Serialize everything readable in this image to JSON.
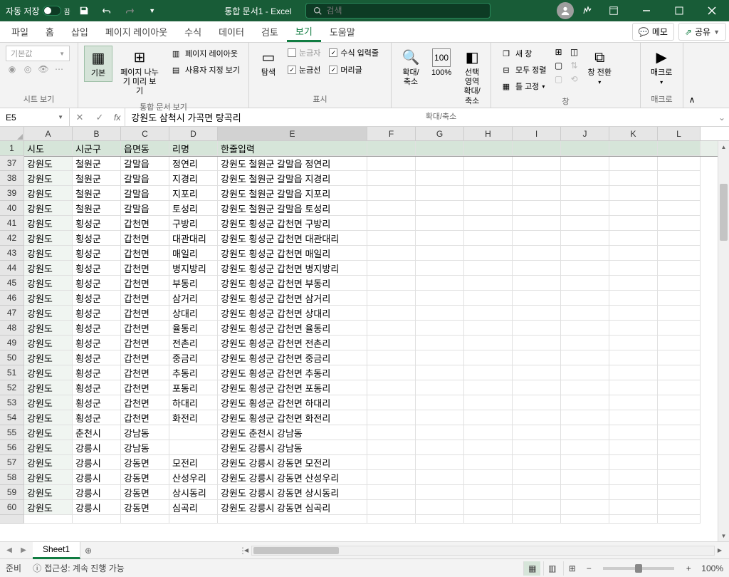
{
  "titlebar": {
    "autosave_label": "자동 저장",
    "autosave_state": "끔",
    "doc_title": "통합 문서1 - Excel",
    "search_placeholder": "검색"
  },
  "menu": {
    "tabs": [
      "파일",
      "홈",
      "삽입",
      "페이지 레이아웃",
      "수식",
      "데이터",
      "검토",
      "보기",
      "도움말"
    ],
    "active_index": 7,
    "memo": "메모",
    "share": "공유"
  },
  "ribbon": {
    "group_sheetview": "시트 보기",
    "sheetview_default": "기본값",
    "group_workbookview": "통합 문서 보기",
    "view_normal": "기본",
    "view_pagebreak": "페이지 나누기 미리 보기",
    "view_pagelayout": "페이지 레이아웃",
    "view_custom": "사용자 지정 보기",
    "group_show": "표시",
    "show_navigate": "탐색",
    "show_ruler": "눈금자",
    "show_formula": "수식 입력줄",
    "show_grid": "눈금선",
    "show_headings": "머리글",
    "group_zoom": "확대/축소",
    "zoom_zoom": "확대/축소",
    "zoom_100": "100%",
    "zoom_selection": "선택 영역 확대/축소",
    "group_window": "창",
    "win_new": "새 창",
    "win_arrange": "모두 정렬",
    "win_freeze": "틀 고정",
    "win_switch": "창 전환",
    "group_macro": "매크로",
    "macro": "매크로"
  },
  "formula": {
    "cell_ref": "E5",
    "value": "강원도 삼척시 가곡면 탕곡리"
  },
  "columns": [
    "A",
    "B",
    "C",
    "D",
    "E",
    "F",
    "G",
    "H",
    "I",
    "J",
    "K",
    "L"
  ],
  "header_row": {
    "num": "1",
    "cells": [
      "시도",
      "시군구",
      "읍면동",
      "리명",
      "한줄입력",
      "",
      "",
      "",
      "",
      "",
      "",
      ""
    ]
  },
  "rows": [
    {
      "num": "37",
      "cells": [
        "강원도",
        "철원군",
        "갈말읍",
        "정연리",
        "강원도 철원군 갈말읍 정연리",
        "",
        "",
        "",
        "",
        "",
        "",
        ""
      ]
    },
    {
      "num": "38",
      "cells": [
        "강원도",
        "철원군",
        "갈말읍",
        "지경리",
        "강원도 철원군 갈말읍 지경리",
        "",
        "",
        "",
        "",
        "",
        "",
        ""
      ]
    },
    {
      "num": "39",
      "cells": [
        "강원도",
        "철원군",
        "갈말읍",
        "지포리",
        "강원도 철원군 갈말읍 지포리",
        "",
        "",
        "",
        "",
        "",
        "",
        ""
      ]
    },
    {
      "num": "40",
      "cells": [
        "강원도",
        "철원군",
        "갈말읍",
        "토성리",
        "강원도 철원군 갈말읍 토성리",
        "",
        "",
        "",
        "",
        "",
        "",
        ""
      ]
    },
    {
      "num": "41",
      "cells": [
        "강원도",
        "횡성군",
        "갑천면",
        "구방리",
        "강원도 횡성군 갑천면 구방리",
        "",
        "",
        "",
        "",
        "",
        "",
        ""
      ]
    },
    {
      "num": "42",
      "cells": [
        "강원도",
        "횡성군",
        "갑천면",
        "대관대리",
        "강원도 횡성군 갑천면 대관대리",
        "",
        "",
        "",
        "",
        "",
        "",
        ""
      ]
    },
    {
      "num": "43",
      "cells": [
        "강원도",
        "횡성군",
        "갑천면",
        "매일리",
        "강원도 횡성군 갑천면 매일리",
        "",
        "",
        "",
        "",
        "",
        "",
        ""
      ]
    },
    {
      "num": "44",
      "cells": [
        "강원도",
        "횡성군",
        "갑천면",
        "병지방리",
        "강원도 횡성군 갑천면 병지방리",
        "",
        "",
        "",
        "",
        "",
        "",
        ""
      ]
    },
    {
      "num": "45",
      "cells": [
        "강원도",
        "횡성군",
        "갑천면",
        "부동리",
        "강원도 횡성군 갑천면 부동리",
        "",
        "",
        "",
        "",
        "",
        "",
        ""
      ]
    },
    {
      "num": "46",
      "cells": [
        "강원도",
        "횡성군",
        "갑천면",
        "삼거리",
        "강원도 횡성군 갑천면 삼거리",
        "",
        "",
        "",
        "",
        "",
        "",
        ""
      ]
    },
    {
      "num": "47",
      "cells": [
        "강원도",
        "횡성군",
        "갑천면",
        "상대리",
        "강원도 횡성군 갑천면 상대리",
        "",
        "",
        "",
        "",
        "",
        "",
        ""
      ]
    },
    {
      "num": "48",
      "cells": [
        "강원도",
        "횡성군",
        "갑천면",
        "율동리",
        "강원도 횡성군 갑천면 율동리",
        "",
        "",
        "",
        "",
        "",
        "",
        ""
      ]
    },
    {
      "num": "49",
      "cells": [
        "강원도",
        "횡성군",
        "갑천면",
        "전촌리",
        "강원도 횡성군 갑천면 전촌리",
        "",
        "",
        "",
        "",
        "",
        "",
        ""
      ]
    },
    {
      "num": "50",
      "cells": [
        "강원도",
        "횡성군",
        "갑천면",
        "중금리",
        "강원도 횡성군 갑천면 중금리",
        "",
        "",
        "",
        "",
        "",
        "",
        ""
      ]
    },
    {
      "num": "51",
      "cells": [
        "강원도",
        "횡성군",
        "갑천면",
        "추동리",
        "강원도 횡성군 갑천면 추동리",
        "",
        "",
        "",
        "",
        "",
        "",
        ""
      ]
    },
    {
      "num": "52",
      "cells": [
        "강원도",
        "횡성군",
        "갑천면",
        "포동리",
        "강원도 횡성군 갑천면 포동리",
        "",
        "",
        "",
        "",
        "",
        "",
        ""
      ]
    },
    {
      "num": "53",
      "cells": [
        "강원도",
        "횡성군",
        "갑천면",
        "하대리",
        "강원도 횡성군 갑천면 하대리",
        "",
        "",
        "",
        "",
        "",
        "",
        ""
      ]
    },
    {
      "num": "54",
      "cells": [
        "강원도",
        "횡성군",
        "갑천면",
        "화전리",
        "강원도 횡성군 갑천면 화전리",
        "",
        "",
        "",
        "",
        "",
        "",
        ""
      ]
    },
    {
      "num": "55",
      "cells": [
        "강원도",
        "춘천시",
        "강남동",
        "",
        "강원도 춘천시 강남동",
        "",
        "",
        "",
        "",
        "",
        "",
        ""
      ]
    },
    {
      "num": "56",
      "cells": [
        "강원도",
        "강릉시",
        "강남동",
        "",
        "강원도 강릉시 강남동",
        "",
        "",
        "",
        "",
        "",
        "",
        ""
      ]
    },
    {
      "num": "57",
      "cells": [
        "강원도",
        "강릉시",
        "강동면",
        "모전리",
        "강원도 강릉시 강동면 모전리",
        "",
        "",
        "",
        "",
        "",
        "",
        ""
      ]
    },
    {
      "num": "58",
      "cells": [
        "강원도",
        "강릉시",
        "강동면",
        "산성우리",
        "강원도 강릉시 강동면 산성우리",
        "",
        "",
        "",
        "",
        "",
        "",
        ""
      ]
    },
    {
      "num": "59",
      "cells": [
        "강원도",
        "강릉시",
        "강동면",
        "상시동리",
        "강원도 강릉시 강동면 상시동리",
        "",
        "",
        "",
        "",
        "",
        "",
        ""
      ]
    },
    {
      "num": "60",
      "cells": [
        "강원도",
        "강릉시",
        "강동면",
        "심곡리",
        "강원도 강릉시 강동면 심곡리",
        "",
        "",
        "",
        "",
        "",
        "",
        ""
      ]
    }
  ],
  "sheet": {
    "name": "Sheet1"
  },
  "status": {
    "ready": "준비",
    "accessibility": "접근성: 계속 진행 가능",
    "zoom": "100%"
  },
  "col_widths": [
    "cw-A",
    "cw-B",
    "cw-C",
    "cw-D",
    "cw-E",
    "cw-F",
    "cw-G",
    "cw-H",
    "cw-I",
    "cw-J",
    "cw-K",
    "cw-L"
  ]
}
